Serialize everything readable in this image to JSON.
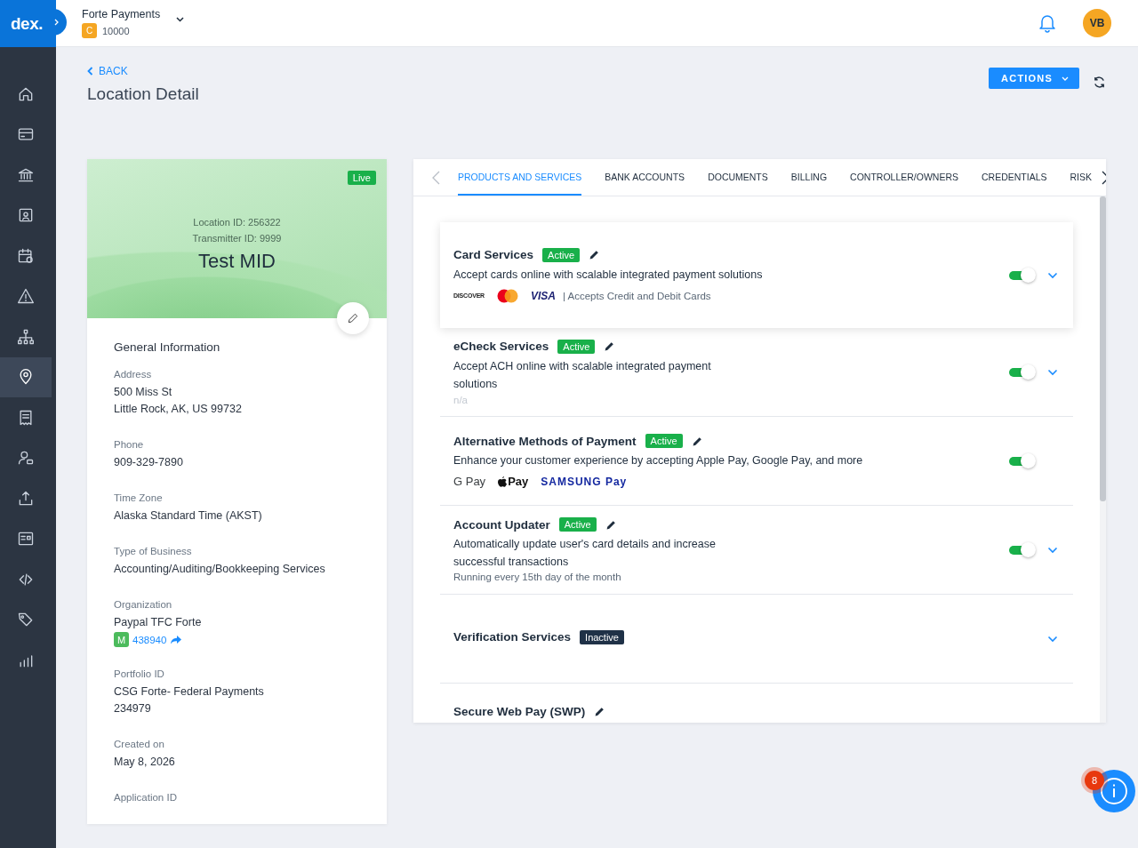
{
  "brand": {
    "logo": "dex."
  },
  "account": {
    "name": "Forte Payments",
    "badge": "C",
    "number": "10000"
  },
  "user": {
    "initials": "VB"
  },
  "sidebar": {
    "items": [
      {
        "kind": "home",
        "selected": false
      },
      {
        "kind": "card",
        "selected": false
      },
      {
        "kind": "bank",
        "selected": false
      },
      {
        "kind": "contacts",
        "selected": false
      },
      {
        "kind": "calendar",
        "selected": false
      },
      {
        "kind": "alert",
        "selected": false
      },
      {
        "kind": "hierarchy",
        "selected": false
      },
      {
        "kind": "location",
        "selected": true
      },
      {
        "kind": "receipt",
        "selected": false
      },
      {
        "kind": "user",
        "selected": false
      },
      {
        "kind": "upload",
        "selected": false
      },
      {
        "kind": "form",
        "selected": false
      },
      {
        "kind": "code",
        "selected": false
      },
      {
        "kind": "tags",
        "selected": false
      },
      {
        "kind": "chart",
        "selected": false
      }
    ]
  },
  "page": {
    "back": "BACK",
    "title": "Location Detail",
    "actions": "ACTIONS"
  },
  "location": {
    "status": "Live",
    "location_id": "Location ID: 256322",
    "transmitter_id": "Transmitter ID: 9999",
    "name": "Test MID",
    "section_title": "General Information",
    "fields": [
      {
        "label": "Address",
        "lines": [
          "500 Miss St",
          "Little Rock, AK, US 99732"
        ]
      },
      {
        "label": "Phone",
        "lines": [
          "909-329-7890"
        ]
      },
      {
        "label": "Time Zone",
        "lines": [
          "Alaska Standard Time (AKST)"
        ]
      },
      {
        "label": "Type of Business",
        "lines": [
          "Accounting/Auditing/Bookkeeping Services"
        ]
      },
      {
        "label": "Organization",
        "lines": [
          "Paypal TFC Forte"
        ],
        "link": {
          "badge": "M",
          "text": "438940"
        }
      },
      {
        "label": "Portfolio ID",
        "lines": [
          "CSG Forte- Federal Payments",
          "234979"
        ]
      },
      {
        "label": "Created on",
        "lines": [
          "May 8, 2026"
        ]
      },
      {
        "label": "Application ID"
      }
    ]
  },
  "tabs": [
    {
      "label": "PRODUCTS AND SERVICES",
      "selected": true
    },
    {
      "label": "BANK ACCOUNTS",
      "selected": false
    },
    {
      "label": "DOCUMENTS",
      "selected": false
    },
    {
      "label": "BILLING",
      "selected": false
    },
    {
      "label": "CONTROLLER/OWNERS",
      "selected": false
    },
    {
      "label": "CREDENTIALS",
      "selected": false
    },
    {
      "label": "RISK",
      "selected": false
    }
  ],
  "services": [
    {
      "name": "Card Services",
      "status": {
        "label": "Active",
        "kind": "active"
      },
      "editable": true,
      "description": "Accept cards online with scalable integrated payment solutions",
      "details": {
        "kind": "logos",
        "logos": [
          {
            "kind": "discover",
            "text": "DISCOVER"
          },
          {
            "kind": "mastercard"
          },
          {
            "kind": "visa",
            "text": "VISA"
          }
        ],
        "note": "| Accepts Credit and Debit Cards"
      },
      "toggle": {
        "on": true
      },
      "expandable": true,
      "selected": true
    },
    {
      "name": "eCheck Services",
      "status": {
        "label": "Active",
        "kind": "active"
      },
      "editable": true,
      "description": "Accept ACH online with scalable integrated payment solutions",
      "details": {
        "kind": "placeholder",
        "text": "n/a"
      },
      "toggle": {
        "on": true
      },
      "expandable": true,
      "selected": false
    },
    {
      "name": "Alternative Methods of Payment",
      "status": {
        "label": "Active",
        "kind": "active"
      },
      "editable": true,
      "description": "Enhance your customer experience by accepting Apple Pay, Google Pay, and more",
      "details": {
        "kind": "logos",
        "logos": [
          {
            "kind": "gpay",
            "text": "G Pay"
          },
          {
            "kind": "applepay",
            "text": "Pay"
          },
          {
            "kind": "samsungpay",
            "text": "SAMSUNG Pay"
          }
        ]
      },
      "toggle": {
        "on": true
      },
      "expandable": false,
      "selected": false
    },
    {
      "name": "Account Updater",
      "status": {
        "label": "Active",
        "kind": "active"
      },
      "editable": true,
      "description": "Automatically update user's card details and increase successful transactions",
      "details": {
        "kind": "note",
        "text": "Running every 15th day of the month"
      },
      "toggle": {
        "on": true
      },
      "expandable": true,
      "selected": false
    },
    {
      "name": "Verification Services",
      "status": {
        "label": "Inactive",
        "kind": "inactive"
      },
      "editable": false,
      "expandable": true,
      "selected": false
    },
    {
      "name": "Secure Web Pay (SWP)",
      "editable": true,
      "expandable": false,
      "selected": false
    }
  ],
  "help": {
    "count": "8"
  }
}
